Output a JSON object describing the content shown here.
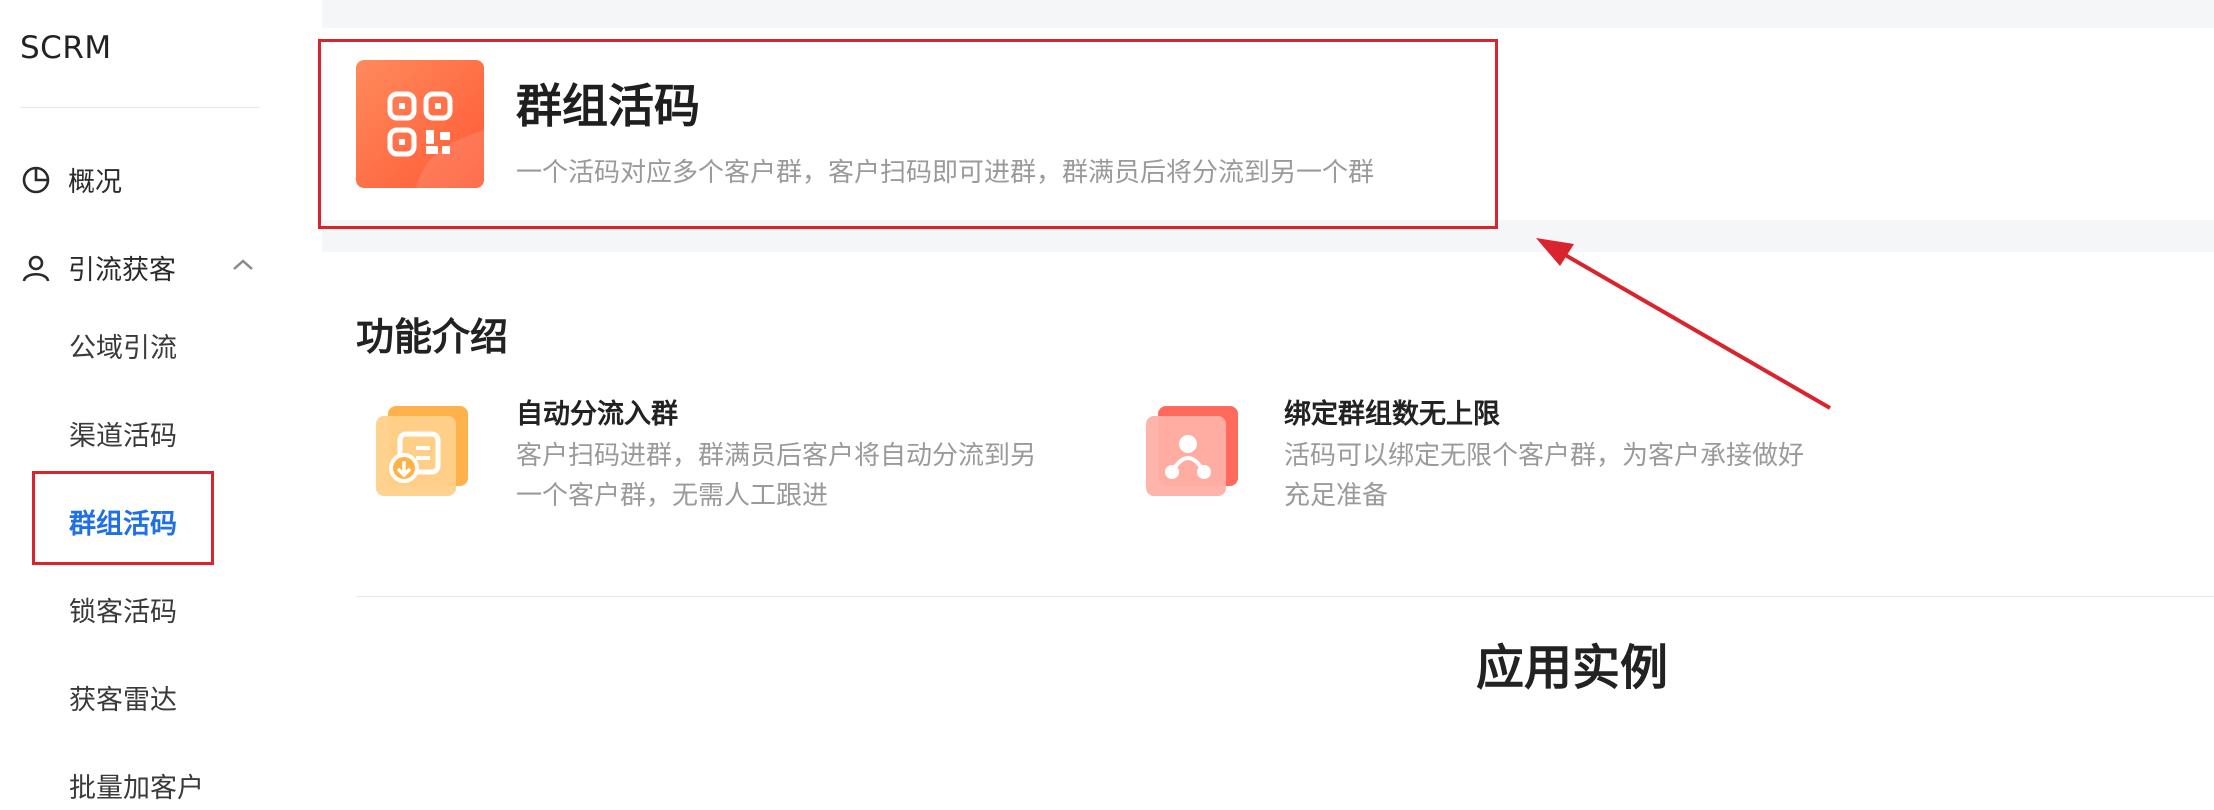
{
  "sidebar": {
    "brand": "SCRM",
    "items": [
      {
        "label": "概况",
        "icon": "pie-chart-icon"
      },
      {
        "label": "引流获客",
        "icon": "user-icon",
        "expanded": true
      }
    ],
    "sub_items": [
      {
        "label": "公域引流",
        "active": false
      },
      {
        "label": "渠道活码",
        "active": false
      },
      {
        "label": "群组活码",
        "active": true
      },
      {
        "label": "锁客活码",
        "active": false
      },
      {
        "label": "获客雷达",
        "active": false
      },
      {
        "label": "批量加客户",
        "active": false
      }
    ]
  },
  "header": {
    "title": "群组活码",
    "description": "一个活码对应多个客户群，客户扫码即可进群，群满员后将分流到另一个群",
    "icon": "qr-code-icon"
  },
  "intro": {
    "title": "功能介绍",
    "features": [
      {
        "title": "自动分流入群",
        "desc_line1": "客户扫码进群，群满员后客户将自动分流到另",
        "desc_line2": "一个客户群，无需人工跟进",
        "icon": "auto-route-icon"
      },
      {
        "title": "绑定群组数无上限",
        "desc_line1": "活码可以绑定无限个客户群，为客户承接做好",
        "desc_line2": "充足准备",
        "icon": "group-network-icon"
      }
    ]
  },
  "examples": {
    "title": "应用实例"
  },
  "colors": {
    "accent": "#1f6fe5",
    "highlight": "#d9242d",
    "icon_orange": "#ff6a3d"
  }
}
